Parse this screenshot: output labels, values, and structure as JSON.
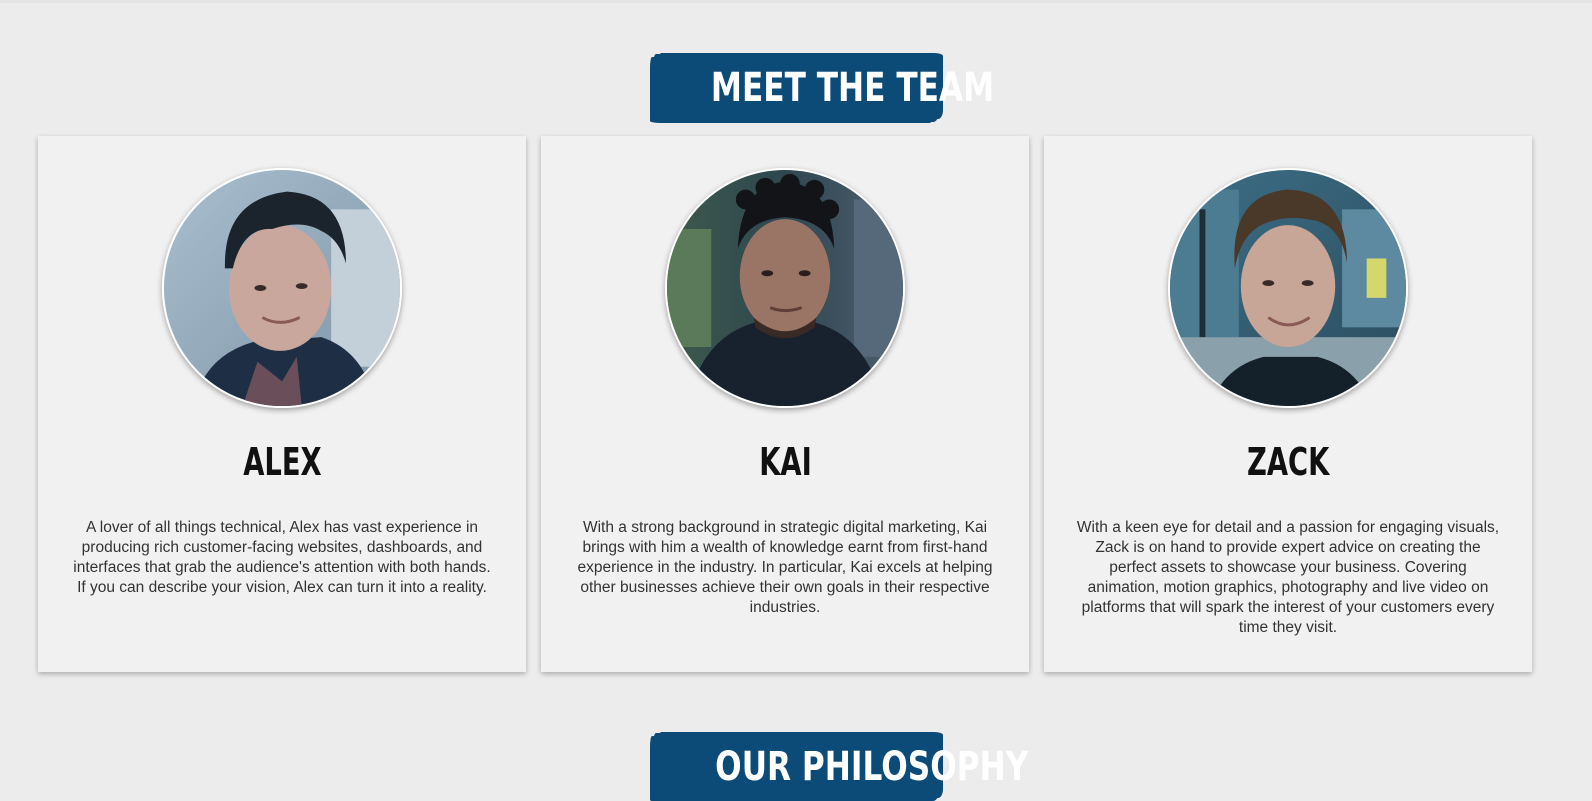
{
  "sections": {
    "team_heading": "MEET THE TEAM",
    "philosophy_heading": "OUR PHILOSOPHY"
  },
  "team": [
    {
      "name": "ALEX",
      "bio": "A lover of all things technical, Alex has vast experience in producing rich customer-facing websites, dashboards, and interfaces that grab the audience's attention with both hands. If you can describe your vision, Alex can turn it into a reality."
    },
    {
      "name": "KAI",
      "bio": "With a strong background in strategic digital marketing, Kai brings with him a wealth of knowledge earnt from first-hand experience in the industry. In particular, Kai excels at helping other businesses achieve their own goals in their respective industries."
    },
    {
      "name": "ZACK",
      "bio": "With a keen eye for detail and a passion for engaging visuals, Zack is on hand to provide expert advice on creating the perfect assets to showcase your business. Covering animation, motion graphics, photography and live video on platforms that will spark the interest of your customers every time they visit."
    }
  ],
  "colors": {
    "heading_bg": "#0c4a78",
    "page_bg": "#ececec",
    "card_bg": "#f1f1f1"
  }
}
